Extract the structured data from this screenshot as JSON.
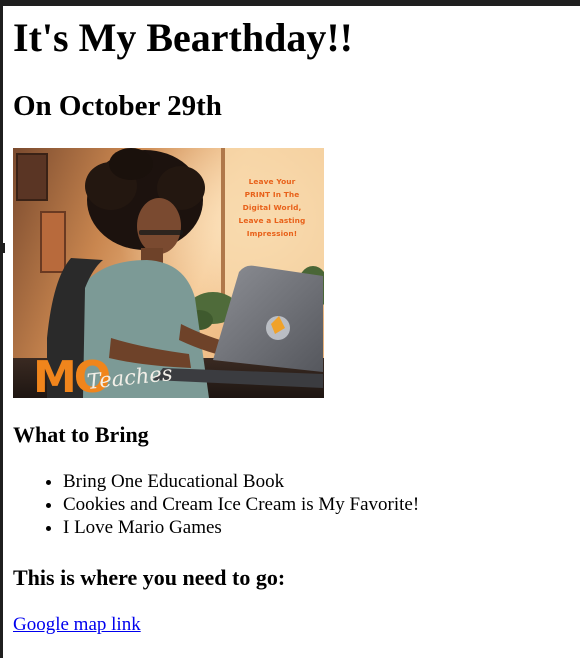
{
  "page": {
    "title": "It's My Bearthday!!",
    "subtitle": "On October 29th"
  },
  "image": {
    "description_icon": "girl-with-laptop-illustration",
    "poster_text": "Leave Your PRINT In The Digital World, Leave a Lasting Impression!",
    "brand_logo_text": "MO",
    "brand_script_text": "Teaches"
  },
  "bring_section": {
    "heading": "What to Bring",
    "items": [
      "Bring One Educational Book",
      "Cookies and Cream Ice Cream is My Favorite!",
      "I Love Mario Games"
    ]
  },
  "location_section": {
    "heading": "This is where you need to go:",
    "link_text": "Google map link"
  },
  "colors": {
    "link": "#0000ee",
    "poster_accent": "#e8611a",
    "brand_orange": "#f0851c"
  }
}
